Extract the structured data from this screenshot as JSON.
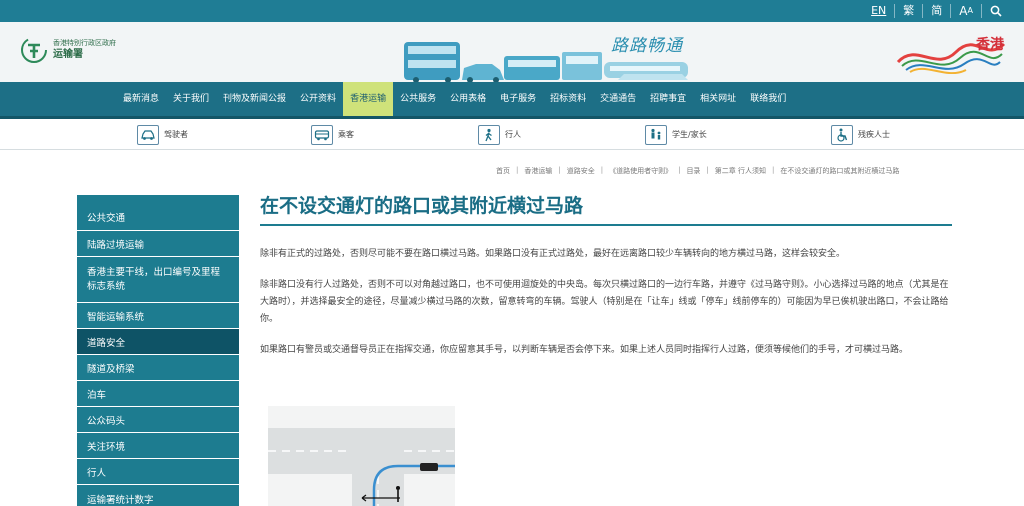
{
  "topbar": {
    "lang_en": "EN",
    "lang_tc": "繁",
    "lang_sc": "简",
    "font_size": "A",
    "search_icon": "search-icon"
  },
  "header": {
    "gov_name": "香港特别行政区政府",
    "dept_name": "运输署",
    "slogan": "路路畅通",
    "brand": "香港"
  },
  "mainnav": {
    "items": [
      "最新消息",
      "关于我们",
      "刊物及新闻公报",
      "公开资料",
      "香港运输",
      "公共服务",
      "公用表格",
      "电子服务",
      "招标资料",
      "交通通告",
      "招聘事宜",
      "相关网址",
      "联络我们"
    ],
    "active_index": 4
  },
  "audience": {
    "items": [
      {
        "label": "驾驶者",
        "icon": "car-icon"
      },
      {
        "label": "乘客",
        "icon": "bus-icon"
      },
      {
        "label": "行人",
        "icon": "pedestrian-icon"
      },
      {
        "label": "学生/家长",
        "icon": "family-icon"
      },
      {
        "label": "残疾人士",
        "icon": "wheelchair-icon"
      }
    ]
  },
  "breadcrumb": [
    "首页",
    "香港运输",
    "道路安全",
    "《道路使用者守则》",
    "目录",
    "第二章 行人须知",
    "在不设交通灯的路口或其附近横过马路"
  ],
  "sidebar": {
    "items": [
      "公共交通",
      "陆路过境运输",
      "香港主要干线，出口编号及里程标志系统",
      "智能运输系统",
      "道路安全",
      "隧道及桥梁",
      "泊车",
      "公众码头",
      "关注环境",
      "行人",
      "运输署统计数字"
    ],
    "active_index": 4
  },
  "content": {
    "title": "在不设交通灯的路口或其附近横过马路",
    "p1": "除非有正式的过路处，否则尽可能不要在路口横过马路。如果路口没有正式过路处，最好在远离路口较少车辆转向的地方横过马路，这样会较安全。",
    "p2": "除非路口没有行人过路处，否则不可以对角越过路口，也不可使用迴旋处的中央岛。每次只横过路口的一边行车路，并遵守《过马路守则》。小心选择过马路的地点（尤其是在大路时），并选择最安全的途径，尽量减少横过马路的次数，留意转弯的车辆。驾驶人（特别是在「让车」线或「停车」线前停车的）可能因为早已俟机驶出路口，不会让路给你。",
    "p3": "如果路口有警员或交通督导员正在指挥交通，你应留意其手号，以判断车辆是否会停下来。如果上述人员同时指挥行人过路，便须等候他们的手号，才可横过马路。"
  },
  "colors": {
    "primary": "#1d7c90",
    "nav": "#1d6f86",
    "nav_active": "#cfe27a",
    "title": "#1a6d85"
  }
}
